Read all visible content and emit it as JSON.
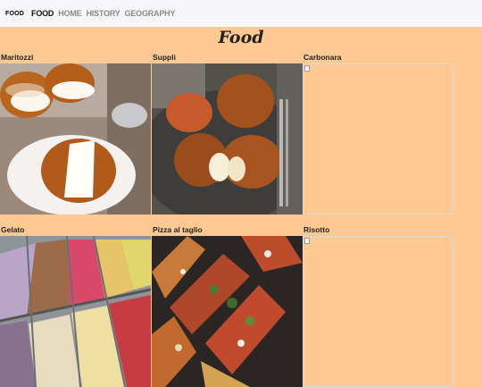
{
  "navbar": {
    "brand": "FOOD",
    "links": [
      {
        "label": "FOOD",
        "active": true
      },
      {
        "label": "HOME",
        "active": false
      },
      {
        "label": "HISTORY",
        "active": false
      },
      {
        "label": "GEOGRAPHY",
        "active": false
      }
    ]
  },
  "page": {
    "title": "Food"
  },
  "items": [
    {
      "name": "Maritozzi",
      "image": "maritozzi-photo"
    },
    {
      "name": "Suppli",
      "image": "suppli-photo"
    },
    {
      "name": "Carbonara",
      "image": "broken-image"
    },
    {
      "name": "Gelato",
      "image": "gelato-photo"
    },
    {
      "name": "Pizza al taglio",
      "image": "pizza-photo"
    },
    {
      "name": "Risotto",
      "image": "broken-image"
    }
  ],
  "colors": {
    "background": "#ffc994",
    "navbar": "#f7f7f9"
  }
}
